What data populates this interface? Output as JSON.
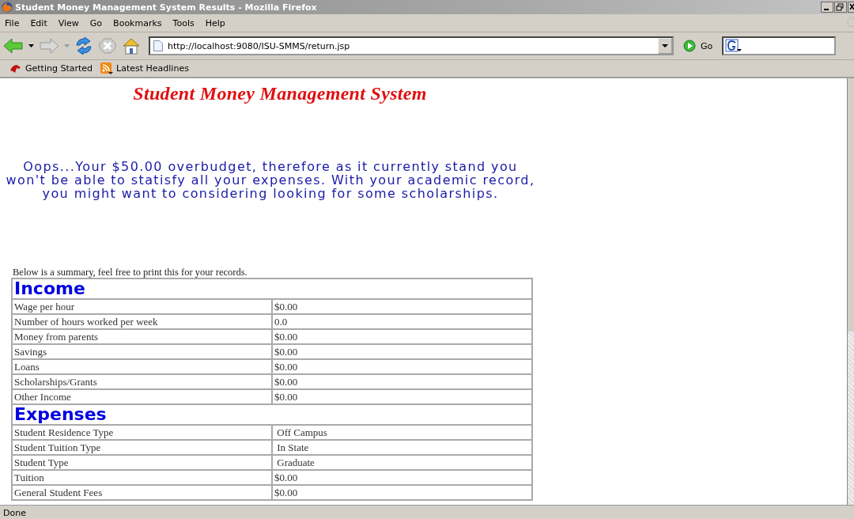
{
  "window": {
    "title": "Student Money Management System Results - Mozilla Firefox"
  },
  "menu": [
    "File",
    "Edit",
    "View",
    "Go",
    "Bookmarks",
    "Tools",
    "Help"
  ],
  "toolbar": {
    "address": "http://localhost:9080/ISU-SMMS/return.jsp",
    "go": "Go"
  },
  "bookmarks": [
    {
      "label": "Getting Started",
      "kind": "page"
    },
    {
      "label": "Latest Headlines",
      "kind": "feed"
    }
  ],
  "page": {
    "heading": "Student Money Management System",
    "message": "Oops...Your $50.00 overbudget, therefore as it currently stand you won't be able to statisfy all your expenses. With your academic record, you might want to considering looking for some scholarships.",
    "intro": "Below is a summary, feel free to print this for your records.",
    "sections": [
      {
        "title": "Income",
        "rows": [
          {
            "label": "Wage per hour",
            "value": "$0.00"
          },
          {
            "label": "Number of hours worked per week",
            "value": "0.0"
          },
          {
            "label": "Money from parents",
            "value": "$0.00"
          },
          {
            "label": "Savings",
            "value": "$0.00"
          },
          {
            "label": "Loans",
            "value": "$0.00"
          },
          {
            "label": "Scholarships/Grants",
            "value": "$0.00"
          },
          {
            "label": "Other Income",
            "value": "$0.00"
          }
        ]
      },
      {
        "title": "Expenses",
        "rows": [
          {
            "label": "Student Residence Type",
            "value": " Off Campus"
          },
          {
            "label": "Student Tuition Type",
            "value": " In State"
          },
          {
            "label": "Student Type",
            "value": " Graduate"
          },
          {
            "label": "Tuition",
            "value": "$0.00"
          },
          {
            "label": "General Student Fees",
            "value": "$0.00"
          }
        ]
      }
    ]
  },
  "status_bar": "Done"
}
